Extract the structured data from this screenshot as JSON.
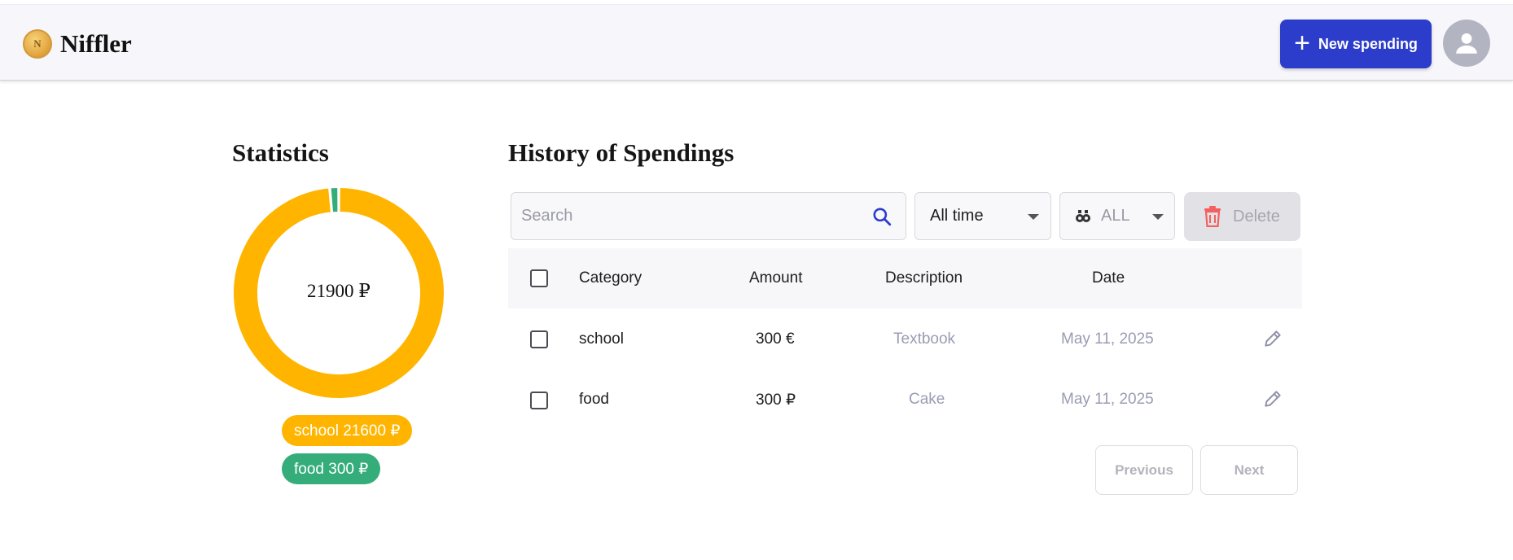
{
  "header": {
    "brand": "Niffler",
    "coin_letter": "N",
    "new_spending_label": "New spending"
  },
  "statistics": {
    "title": "Statistics",
    "total": "21900 ₽",
    "legend": [
      {
        "label": "school 21600 ₽",
        "color": "#ffb500"
      },
      {
        "label": "food 300 ₽",
        "color": "#35ad7b"
      }
    ]
  },
  "chart_data": {
    "type": "pie",
    "categories": [
      "school",
      "food"
    ],
    "values": [
      21600,
      300
    ],
    "colors": [
      "#ffb500",
      "#35ad7b"
    ],
    "total_label": "21900 ₽"
  },
  "history": {
    "title": "History of Spendings",
    "search_placeholder": "Search",
    "period_select": "All time",
    "currency_select": "ALL",
    "delete_label": "Delete",
    "columns": [
      "Category",
      "Amount",
      "Description",
      "Date"
    ],
    "rows": [
      {
        "category": "school",
        "amount": "300 €",
        "description": "Textbook",
        "date": "May 11, 2025"
      },
      {
        "category": "food",
        "amount": "300 ₽",
        "description": "Cake",
        "date": "May 11, 2025"
      }
    ],
    "pagination": {
      "previous": "Previous",
      "next": "Next"
    }
  },
  "colors": {
    "accent": "#2c3ccb",
    "school": "#ffb500",
    "food": "#35ad7b",
    "delete_icon": "#f45f5f"
  },
  "icons": [
    "coin-logo-icon",
    "plus-icon",
    "user-avatar-icon",
    "search-icon",
    "chevron-down-icon",
    "coins-icon",
    "trash-icon",
    "edit-icon"
  ]
}
